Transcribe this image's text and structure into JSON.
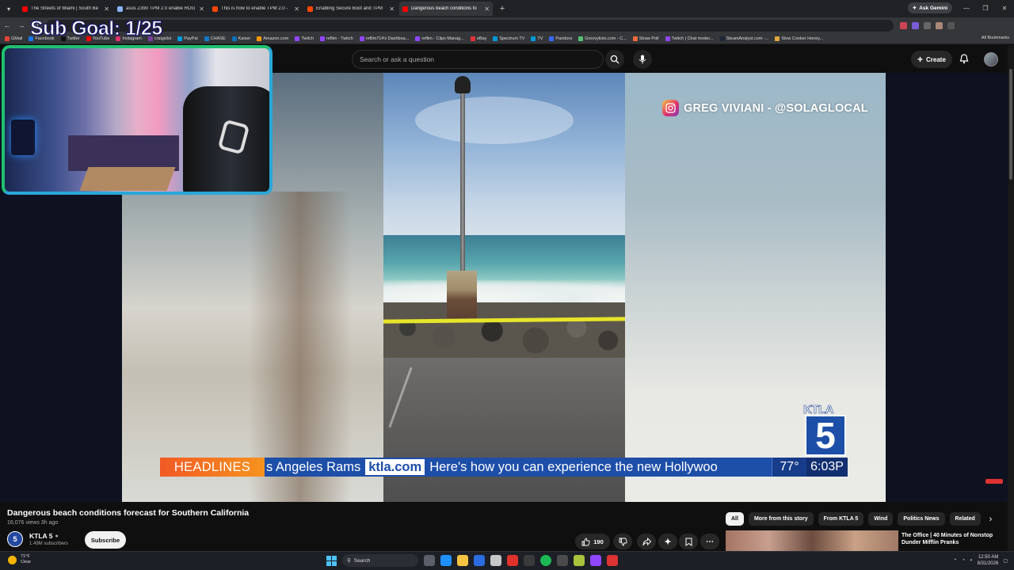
{
  "browser": {
    "tabs": [
      {
        "title": "The Streets of Miami | South Be",
        "color": "#ff0000",
        "active": false
      },
      {
        "title": "asus Z390 TPM 2.0 enable ROG",
        "color": "#8ab4f8",
        "active": false
      },
      {
        "title": "This is how to enable TPM 2.0 -",
        "color": "#ff4500",
        "active": false
      },
      {
        "title": "Enabling Secure Boot and TPM",
        "color": "#ff4500",
        "active": false
      },
      {
        "title": "Dangerous beach conditions fo",
        "color": "#ff0000",
        "active": true
      }
    ],
    "ask_gemini": "Ask Gemini",
    "bookmarks": [
      {
        "label": "GMail",
        "color": "#ea4335"
      },
      {
        "label": "Facebook",
        "color": "#1877f2"
      },
      {
        "label": "Twitter",
        "color": "#111111"
      },
      {
        "label": "YouTube",
        "color": "#ff0000"
      },
      {
        "label": "Instagram",
        "color": "#e1306c"
      },
      {
        "label": "craigslist",
        "color": "#7b3fa0"
      },
      {
        "label": "PayPal",
        "color": "#009cde"
      },
      {
        "label": "CHASE",
        "color": "#117aca"
      },
      {
        "label": "Kaiser",
        "color": "#0b6fb8"
      },
      {
        "label": "Amazon.com",
        "color": "#ff9900"
      },
      {
        "label": "Twitch",
        "color": "#9146ff"
      },
      {
        "label": "reflim - Twitch",
        "color": "#9146ff"
      },
      {
        "label": "reflim714's Dashboa...",
        "color": "#9146ff"
      },
      {
        "label": "reflim - Clips Manag...",
        "color": "#9146ff"
      },
      {
        "label": "eBay",
        "color": "#e53238"
      },
      {
        "label": "Spectrum TV",
        "color": "#0099d8"
      },
      {
        "label": "TV",
        "color": "#0099d8"
      },
      {
        "label": "Pandora",
        "color": "#3668ff"
      },
      {
        "label": "Groovylists.com - C...",
        "color": "#56c271"
      },
      {
        "label": "Straw Poll",
        "color": "#f26b3a"
      },
      {
        "label": "Twitch | Chat moder...",
        "color": "#9146ff"
      },
      {
        "label": "SteamAnalyst.com -...",
        "color": "#1b2838"
      },
      {
        "label": "Slow Cooker Honey...",
        "color": "#e0a83b"
      }
    ],
    "all_bookmarks": "All Bookmarks"
  },
  "overlay": {
    "sub_goal": "Sub Goal: 1/25"
  },
  "youtube": {
    "search_placeholder": "Search or ask a question",
    "create_label": "Create",
    "video": {
      "credit": "GREG VIVIANI - @SOLAGLOCAL",
      "logo_word": "KTLA",
      "logo_num": "5",
      "ticker_head": "HEADLINES",
      "ticker_text1": "s Angeles Rams",
      "ticker_site": "ktla.com",
      "ticker_text2": "Here's how you can experience the new Hollywoo",
      "temp": "77°",
      "time": "6:03P"
    },
    "title": "Dangerous beach conditions forecast for Southern California",
    "meta": "16,076 views  3h ago",
    "channel": {
      "name": "KTLA 5",
      "subs": "1.49M subscribers",
      "subscribe_label": "Subscribe"
    },
    "actions": {
      "like_count": "190"
    },
    "chips": [
      "All",
      "More from this story",
      "From KTLA 5",
      "Wind",
      "Politics News",
      "Related"
    ],
    "recommended": {
      "title": "The Office | 40 Minutes of Nonstop Dunder Mifflin Pranks"
    }
  },
  "taskbar": {
    "weather_temp": "71°F",
    "weather_desc": "Clear",
    "search_label": "Search",
    "time": "12:50 AM",
    "date": "8/31/2026"
  }
}
